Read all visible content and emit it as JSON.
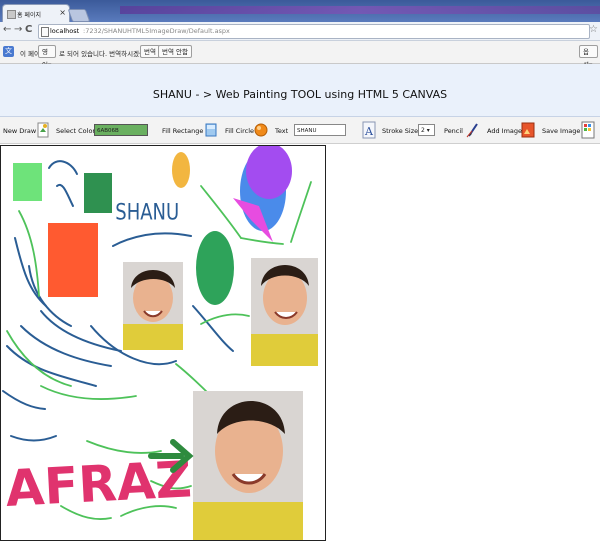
{
  "browser": {
    "tab_title": "홈 페이지",
    "url_host": "localhost",
    "url_path": ":7232/SHANUHTML5ImageDraw/Default.aspx"
  },
  "translate_bar": {
    "message_prefix": "이 페이지는",
    "language": "영어",
    "message_suffix": "로 되어 있습니다. 번역하시겠습니까?",
    "translate_button": "번역",
    "never_button": "번역 안함",
    "options_button": "옵션"
  },
  "header": {
    "title": "SHANU - > Web Painting TOOL using HTML 5 CANVAS"
  },
  "toolbar": {
    "new_draw": "New Draw",
    "select_color": "Select Color",
    "color_value": "6AB06B",
    "fill_rectangle": "Fill Rectange",
    "fill_circle": "Fill Circle",
    "text_label": "Text",
    "text_value": "SHANU",
    "stroke_size_label": "Stroke Size",
    "stroke_size_value": "2",
    "pencil": "Pencil",
    "add_image": "Add Image",
    "save_image": "Save Image"
  },
  "canvas": {
    "text_shanu": "SHANU",
    "text_afraz": "AFRAZ"
  },
  "colors": {
    "header_bg": "#eaf1fb",
    "accent_green": "#6ab060",
    "rect_orange": "#ff5a30",
    "circle_purple": "#a34cf0",
    "text_afraz": "#e0336e"
  }
}
